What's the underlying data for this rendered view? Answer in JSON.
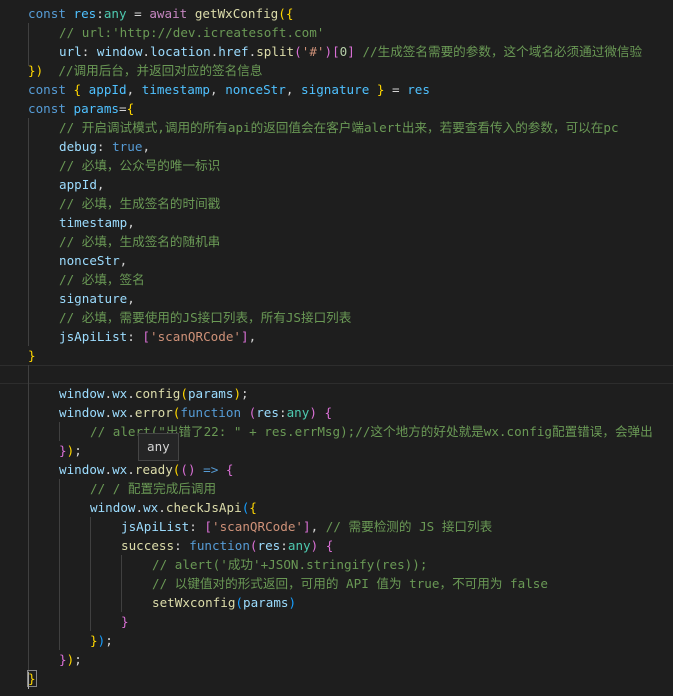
{
  "editor": {
    "language": "javascript",
    "theme": "dark",
    "lines": [
      {
        "indent": 0,
        "tokens": [
          [
            "kw",
            "const "
          ],
          [
            "con",
            "res"
          ],
          [
            "pun",
            ":"
          ],
          [
            "ty",
            "any"
          ],
          [
            "pun",
            " = "
          ],
          [
            "ctl",
            "await "
          ],
          [
            "fn",
            "getWxConfig"
          ],
          [
            "b1",
            "({"
          ]
        ]
      },
      {
        "indent": 1,
        "tokens": [
          [
            "cm",
            "// url:'http://dev.icreatesoft.com'"
          ]
        ]
      },
      {
        "indent": 1,
        "tokens": [
          [
            "var",
            "url"
          ],
          [
            "pun",
            ": "
          ],
          [
            "var",
            "window"
          ],
          [
            "pun",
            "."
          ],
          [
            "var",
            "location"
          ],
          [
            "pun",
            "."
          ],
          [
            "var",
            "href"
          ],
          [
            "pun",
            "."
          ],
          [
            "fn",
            "split"
          ],
          [
            "b2",
            "("
          ],
          [
            "str",
            "'#'"
          ],
          [
            "b2",
            ")"
          ],
          [
            "b2",
            "["
          ],
          [
            "num",
            "0"
          ],
          [
            "b2",
            "]"
          ],
          [
            "pun",
            " "
          ],
          [
            "cm",
            "//生成签名需要的参数，这个域名必须通过微信验"
          ]
        ]
      },
      {
        "indent": 0,
        "tokens": [
          [
            "b1",
            "})"
          ],
          [
            "pun",
            "  "
          ],
          [
            "cm",
            "//调用后台，并返回对应的签名信息"
          ]
        ]
      },
      {
        "indent": 0,
        "tokens": [
          [
            "kw",
            "const "
          ],
          [
            "b1",
            "{ "
          ],
          [
            "con",
            "appId"
          ],
          [
            "pun",
            ", "
          ],
          [
            "con",
            "timestamp"
          ],
          [
            "pun",
            ", "
          ],
          [
            "con",
            "nonceStr"
          ],
          [
            "pun",
            ", "
          ],
          [
            "con",
            "signature"
          ],
          [
            "b1",
            " }"
          ],
          [
            "pun",
            " = "
          ],
          [
            "con",
            "res"
          ]
        ]
      },
      {
        "indent": 0,
        "tokens": [
          [
            "kw",
            "const "
          ],
          [
            "con",
            "params"
          ],
          [
            "pun",
            "="
          ],
          [
            "b1",
            "{"
          ]
        ]
      },
      {
        "indent": 1,
        "tokens": [
          [
            "cm",
            "// 开启调试模式,调用的所有api的返回值会在客户端alert出来，若要查看传入的参数，可以在pc"
          ]
        ]
      },
      {
        "indent": 1,
        "tokens": [
          [
            "var",
            "debug"
          ],
          [
            "pun",
            ": "
          ],
          [
            "kw",
            "true"
          ],
          [
            "pun",
            ","
          ]
        ]
      },
      {
        "indent": 1,
        "tokens": [
          [
            "cm",
            "// 必填，公众号的唯一标识"
          ]
        ]
      },
      {
        "indent": 1,
        "tokens": [
          [
            "var",
            "appId"
          ],
          [
            "pun",
            ","
          ]
        ]
      },
      {
        "indent": 1,
        "tokens": [
          [
            "cm",
            "// 必填，生成签名的时间戳"
          ]
        ]
      },
      {
        "indent": 1,
        "tokens": [
          [
            "var",
            "timestamp"
          ],
          [
            "pun",
            ","
          ]
        ]
      },
      {
        "indent": 1,
        "tokens": [
          [
            "cm",
            "// 必填，生成签名的随机串"
          ]
        ]
      },
      {
        "indent": 1,
        "tokens": [
          [
            "var",
            "nonceStr"
          ],
          [
            "pun",
            ","
          ]
        ]
      },
      {
        "indent": 1,
        "tokens": [
          [
            "cm",
            "// 必填，签名"
          ]
        ]
      },
      {
        "indent": 1,
        "tokens": [
          [
            "var",
            "signature"
          ],
          [
            "pun",
            ","
          ]
        ]
      },
      {
        "indent": 1,
        "tokens": [
          [
            "cm",
            "// 必填，需要使用的JS接口列表，所有JS接口列表"
          ]
        ]
      },
      {
        "indent": 1,
        "tokens": [
          [
            "var",
            "jsApiList"
          ],
          [
            "pun",
            ": "
          ],
          [
            "b2",
            "["
          ],
          [
            "str",
            "'scanQRCode'"
          ],
          [
            "b2",
            "]"
          ],
          [
            "pun",
            ","
          ]
        ]
      },
      {
        "indent": 0,
        "tokens": [
          [
            "b1",
            "}"
          ]
        ]
      },
      {
        "indent": 0,
        "tokens": []
      },
      {
        "indent": 1,
        "tokens": [
          [
            "var",
            "window"
          ],
          [
            "pun",
            "."
          ],
          [
            "var",
            "wx"
          ],
          [
            "pun",
            "."
          ],
          [
            "fn",
            "config"
          ],
          [
            "b1",
            "("
          ],
          [
            "var",
            "params"
          ],
          [
            "b1",
            ")"
          ],
          [
            "pun",
            ";"
          ]
        ]
      },
      {
        "indent": 1,
        "tokens": [
          [
            "var",
            "window"
          ],
          [
            "pun",
            "."
          ],
          [
            "var",
            "wx"
          ],
          [
            "pun",
            "."
          ],
          [
            "fn",
            "error"
          ],
          [
            "b1",
            "("
          ],
          [
            "kw",
            "function "
          ],
          [
            "b2",
            "("
          ],
          [
            "var",
            "res"
          ],
          [
            "pun",
            ":"
          ],
          [
            "ty",
            "any"
          ],
          [
            "b2",
            ")"
          ],
          [
            "pun",
            " "
          ],
          [
            "b2",
            "{"
          ]
        ]
      },
      {
        "indent": 2,
        "tokens": [
          [
            "cm",
            "// alert(\"出错了22: \" + res.errMsg);//这个地方的好处就是wx.config配置错误，会弹出"
          ]
        ]
      },
      {
        "indent": 1,
        "tokens": [
          [
            "b2",
            "}"
          ],
          [
            "b1",
            ")"
          ],
          [
            "pun",
            ";"
          ]
        ]
      },
      {
        "indent": 1,
        "tokens": [
          [
            "var",
            "window"
          ],
          [
            "pun",
            "."
          ],
          [
            "var",
            "wx"
          ],
          [
            "pun",
            "."
          ],
          [
            "fn",
            "ready"
          ],
          [
            "b1",
            "("
          ],
          [
            "b2",
            "()"
          ],
          [
            "pun",
            " "
          ],
          [
            "kw",
            "=>"
          ],
          [
            "pun",
            " "
          ],
          [
            "b2",
            "{"
          ]
        ]
      },
      {
        "indent": 2,
        "tokens": [
          [
            "cm",
            "// / 配置完成后调用"
          ]
        ]
      },
      {
        "indent": 2,
        "tokens": [
          [
            "var",
            "window"
          ],
          [
            "pun",
            "."
          ],
          [
            "var",
            "wx"
          ],
          [
            "pun",
            "."
          ],
          [
            "fn",
            "checkJsApi"
          ],
          [
            "b3",
            "("
          ],
          [
            "b1",
            "{"
          ]
        ]
      },
      {
        "indent": 3,
        "tokens": [
          [
            "var",
            "jsApiList"
          ],
          [
            "pun",
            ": "
          ],
          [
            "b2",
            "["
          ],
          [
            "str",
            "'scanQRCode'"
          ],
          [
            "b2",
            "]"
          ],
          [
            "pun",
            ", "
          ],
          [
            "cm",
            "// 需要检测的 JS 接口列表"
          ]
        ]
      },
      {
        "indent": 3,
        "tokens": [
          [
            "fn",
            "success"
          ],
          [
            "pun",
            ": "
          ],
          [
            "kw",
            "function"
          ],
          [
            "b2",
            "("
          ],
          [
            "var",
            "res"
          ],
          [
            "pun",
            ":"
          ],
          [
            "ty",
            "any"
          ],
          [
            "b2",
            ")"
          ],
          [
            "pun",
            " "
          ],
          [
            "b2",
            "{"
          ]
        ]
      },
      {
        "indent": 4,
        "tokens": [
          [
            "cm",
            "// alert('成功'+JSON.stringify(res));"
          ]
        ]
      },
      {
        "indent": 4,
        "tokens": [
          [
            "cm",
            "// 以键值对的形式返回，可用的 API 值为 true，不可用为 false"
          ]
        ]
      },
      {
        "indent": 4,
        "tokens": [
          [
            "fn",
            "setWxconfig"
          ],
          [
            "b3",
            "("
          ],
          [
            "var",
            "params"
          ],
          [
            "b3",
            ")"
          ]
        ]
      },
      {
        "indent": 3,
        "tokens": [
          [
            "b2",
            "}"
          ]
        ]
      },
      {
        "indent": 2,
        "tokens": [
          [
            "b1",
            "}"
          ],
          [
            "b3",
            ")"
          ],
          [
            "pun",
            ";"
          ]
        ]
      },
      {
        "indent": 1,
        "tokens": [
          [
            "b2",
            "}"
          ],
          [
            "b1",
            ")"
          ],
          [
            "pun",
            ";"
          ]
        ]
      },
      {
        "indent": 0,
        "tokens": [
          [
            "b1",
            "}"
          ]
        ]
      }
    ]
  },
  "hover_tooltip": {
    "text": "any"
  },
  "colors": {
    "background": "#1e1e1e",
    "keyword": "#569cd6",
    "control": "#c586c0",
    "variable": "#9cdcfe",
    "constant": "#4fc1ff",
    "function": "#dcdcaa",
    "string": "#ce9178",
    "comment": "#6a9955",
    "type": "#4ec9b0"
  }
}
